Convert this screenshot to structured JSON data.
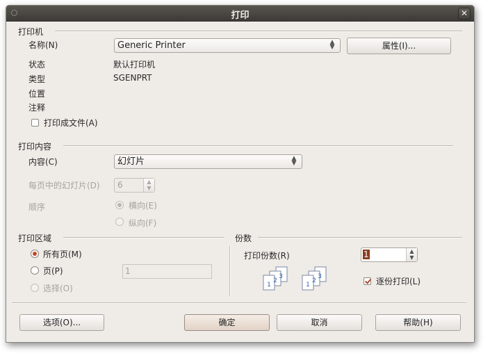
{
  "window": {
    "title": "打印"
  },
  "printer": {
    "section": "打印机",
    "name_label": "名称(N)",
    "name_value": "Generic Printer",
    "properties_button": "属性(I)...",
    "status_label": "状态",
    "status_value": "默认打印机",
    "type_label": "类型",
    "type_value": "SGENPRT",
    "location_label": "位置",
    "comment_label": "注释",
    "print_to_file": "打印成文件(A)",
    "print_to_file_checked": false
  },
  "content": {
    "section": "打印内容",
    "content_label": "内容(C)",
    "content_value": "幻灯片",
    "slides_per_page_label": "每页中的幻灯片(D)",
    "slides_per_page_value": "6",
    "order_label": "顺序",
    "order_horizontal": "横向(E)",
    "order_vertical": "纵向(F)"
  },
  "range": {
    "section": "打印区域",
    "all_pages": "所有页(M)",
    "pages": "页(P)",
    "pages_value": "1",
    "selection": "选择(O)"
  },
  "copies": {
    "section": "份数",
    "count_label": "打印份数(R)",
    "count_value": "1",
    "collate_label": "逐份打印(L)",
    "collate_checked": true,
    "doc_numbers": [
      "1",
      "2",
      "3"
    ]
  },
  "buttons": {
    "options": "选项(O)...",
    "ok": "确定",
    "cancel": "取消",
    "help": "帮助(H)"
  },
  "colors": {
    "accent": "#c14a27",
    "titlebar": "#3c3b37",
    "window_bg": "#efebe7"
  }
}
